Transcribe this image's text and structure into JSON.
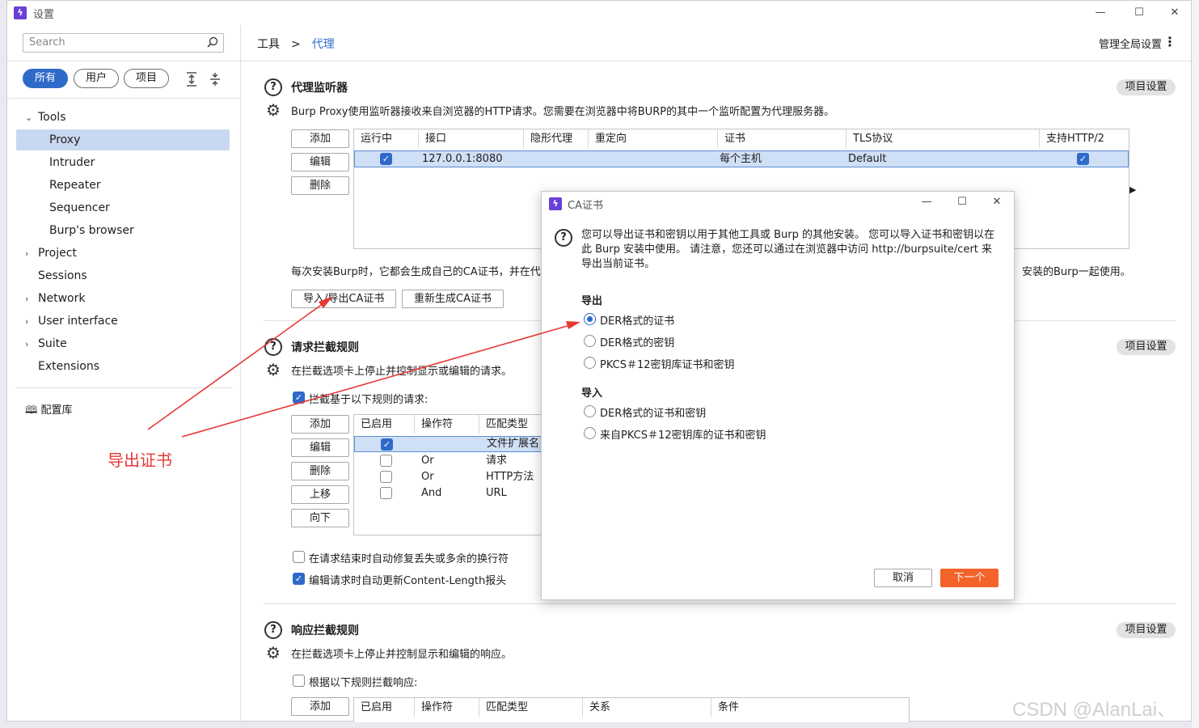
{
  "window": {
    "title": "设置",
    "logo": "burp-logo-icon",
    "minimize": "—",
    "maximize": "☐",
    "close": "✕"
  },
  "search": {
    "placeholder": "Search"
  },
  "filters": {
    "all": "所有",
    "user": "用户",
    "project": "项目"
  },
  "tree": {
    "tools": "Tools",
    "proxy": "Proxy",
    "intruder": "Intruder",
    "repeater": "Repeater",
    "sequencer": "Sequencer",
    "browser": "Burp's browser",
    "project": "Project",
    "sessions": "Sessions",
    "network": "Network",
    "ui": "User interface",
    "suite": "Suite",
    "extensions": "Extensions"
  },
  "library": "配置库",
  "breadcrumb": {
    "root": "工具",
    "sep": ">",
    "current": "代理"
  },
  "global_settings": "管理全局设置",
  "listeners": {
    "title": "代理监听器",
    "desc": "Burp Proxy使用监听器接收来自浏览器的HTTP请求。您需要在浏览器中将BURP的其中一个监听配置为代理服务器。",
    "project_btn": "项目设置",
    "add": "添加",
    "edit": "编辑",
    "remove": "删除",
    "headers": [
      "运行中",
      "接口",
      "隐形代理",
      "重定向",
      "证书",
      "TLS协议",
      "支持HTTP/2"
    ],
    "row": {
      "interface": "127.0.0.1:8080",
      "cert": "每个主机",
      "tls": "Default"
    },
    "ca_note_left": "每次安装Burp时，它都会生成自己的CA证书，并在代理",
    "ca_note_right": "安装的Burp一起使用。",
    "import_export": "导入/导出CA证书",
    "regen": "重新生成CA证书"
  },
  "request_rules": {
    "title": "请求拦截规则",
    "desc": "在拦截选项卡上停止并控制显示或编辑的请求。",
    "project_btn": "项目设置",
    "intercept_label": "拦截基于以下规则的请求:",
    "add": "添加",
    "edit": "编辑",
    "remove": "删除",
    "up": "上移",
    "down": "向下",
    "headers": [
      "已启用",
      "操作符",
      "匹配类型"
    ],
    "rows": [
      {
        "op": "",
        "type": "文件扩展名"
      },
      {
        "op": "Or",
        "type": "请求"
      },
      {
        "op": "Or",
        "type": "HTTP方法"
      },
      {
        "op": "And",
        "type": "URL"
      }
    ],
    "fix_newlines": "在请求结束时自动修复丢失或多余的换行符",
    "update_length": "编辑请求时自动更新Content-Length报头"
  },
  "response_rules": {
    "title": "响应拦截规则",
    "desc": "在拦截选项卡上停止并控制显示和编辑的响应。",
    "project_btn": "项目设置",
    "intercept_label": "根据以下规则拦截响应:",
    "add": "添加",
    "headers": [
      "已启用",
      "操作符",
      "匹配类型",
      "关系",
      "条件"
    ]
  },
  "dialog": {
    "title": "CA证书",
    "info": "您可以导出证书和密钥以用于其他工具或 Burp 的其他安装。 您可以导入证书和密钥以在此 Burp 安装中使用。 请注意，您还可以通过在浏览器中访问 http://burpsuite/cert 来导出当前证书。",
    "export_label": "导出",
    "export_options": [
      "DER格式的证书",
      "DER格式的密钥",
      "PKCS＃12密钥库证书和密钥"
    ],
    "import_label": "导入",
    "import_options": [
      "DER格式的证书和密钥",
      "来自PKCS＃12密钥库的证书和密钥"
    ],
    "cancel": "取消",
    "next": "下一个"
  },
  "annotation": "导出证书",
  "watermark": "CSDN @AlanLai、",
  "colors": {
    "accent": "#2f6ac9",
    "orange": "#f4632a",
    "annotation": "#e53935"
  }
}
